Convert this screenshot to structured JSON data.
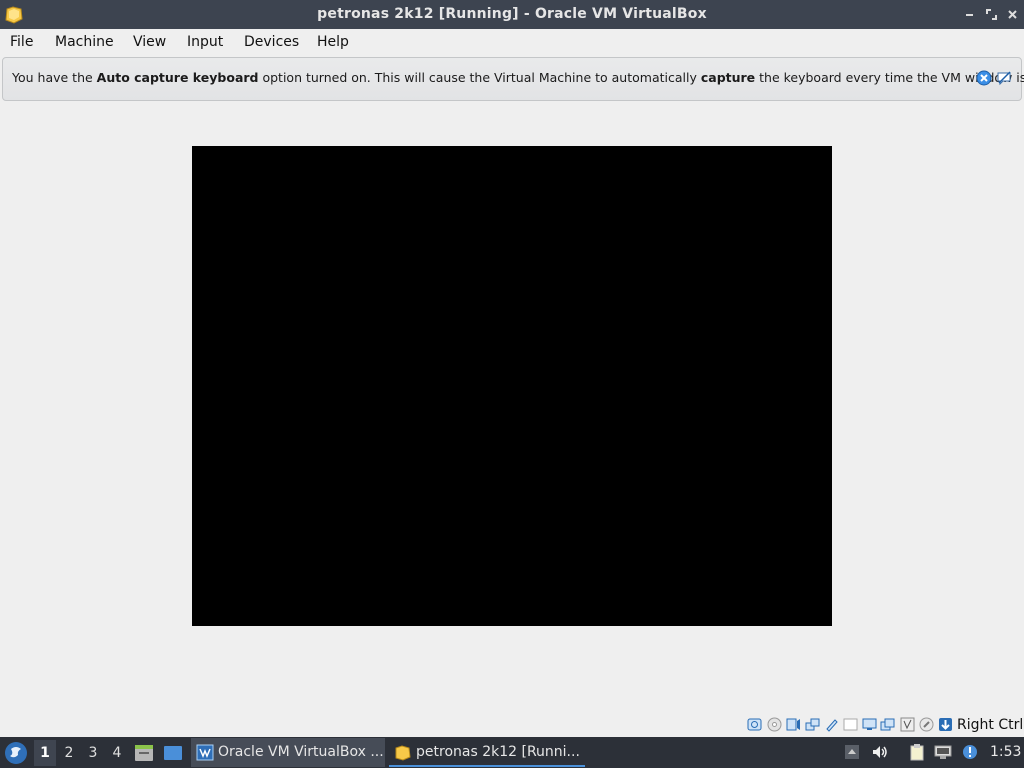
{
  "window": {
    "title": "petronas 2k12 [Running] - Oracle VM VirtualBox"
  },
  "menu": {
    "items": [
      "File",
      "Machine",
      "View",
      "Input",
      "Devices",
      "Help"
    ]
  },
  "banner": {
    "text_1": "You have the ",
    "bold_1": "Auto capture keyboard",
    "text_2": " option turned on. This will cause the Virtual Machine to automatically ",
    "bold_2": "capture",
    "text_3": " the keyboard every time the VM window is"
  },
  "statusbar": {
    "host_key": "Right Ctrl"
  },
  "taskbar": {
    "workspaces": [
      "1",
      "2",
      "3",
      "4"
    ],
    "tasks": [
      {
        "label": "Oracle VM VirtualBox ..."
      },
      {
        "label": "petronas 2k12 [Runni..."
      }
    ],
    "clock": "1:53"
  },
  "colors": {
    "titlebar": "#3d4450",
    "taskbar": "#2c3038",
    "vm_screen": "#000000",
    "accent": "#4a90d9"
  }
}
